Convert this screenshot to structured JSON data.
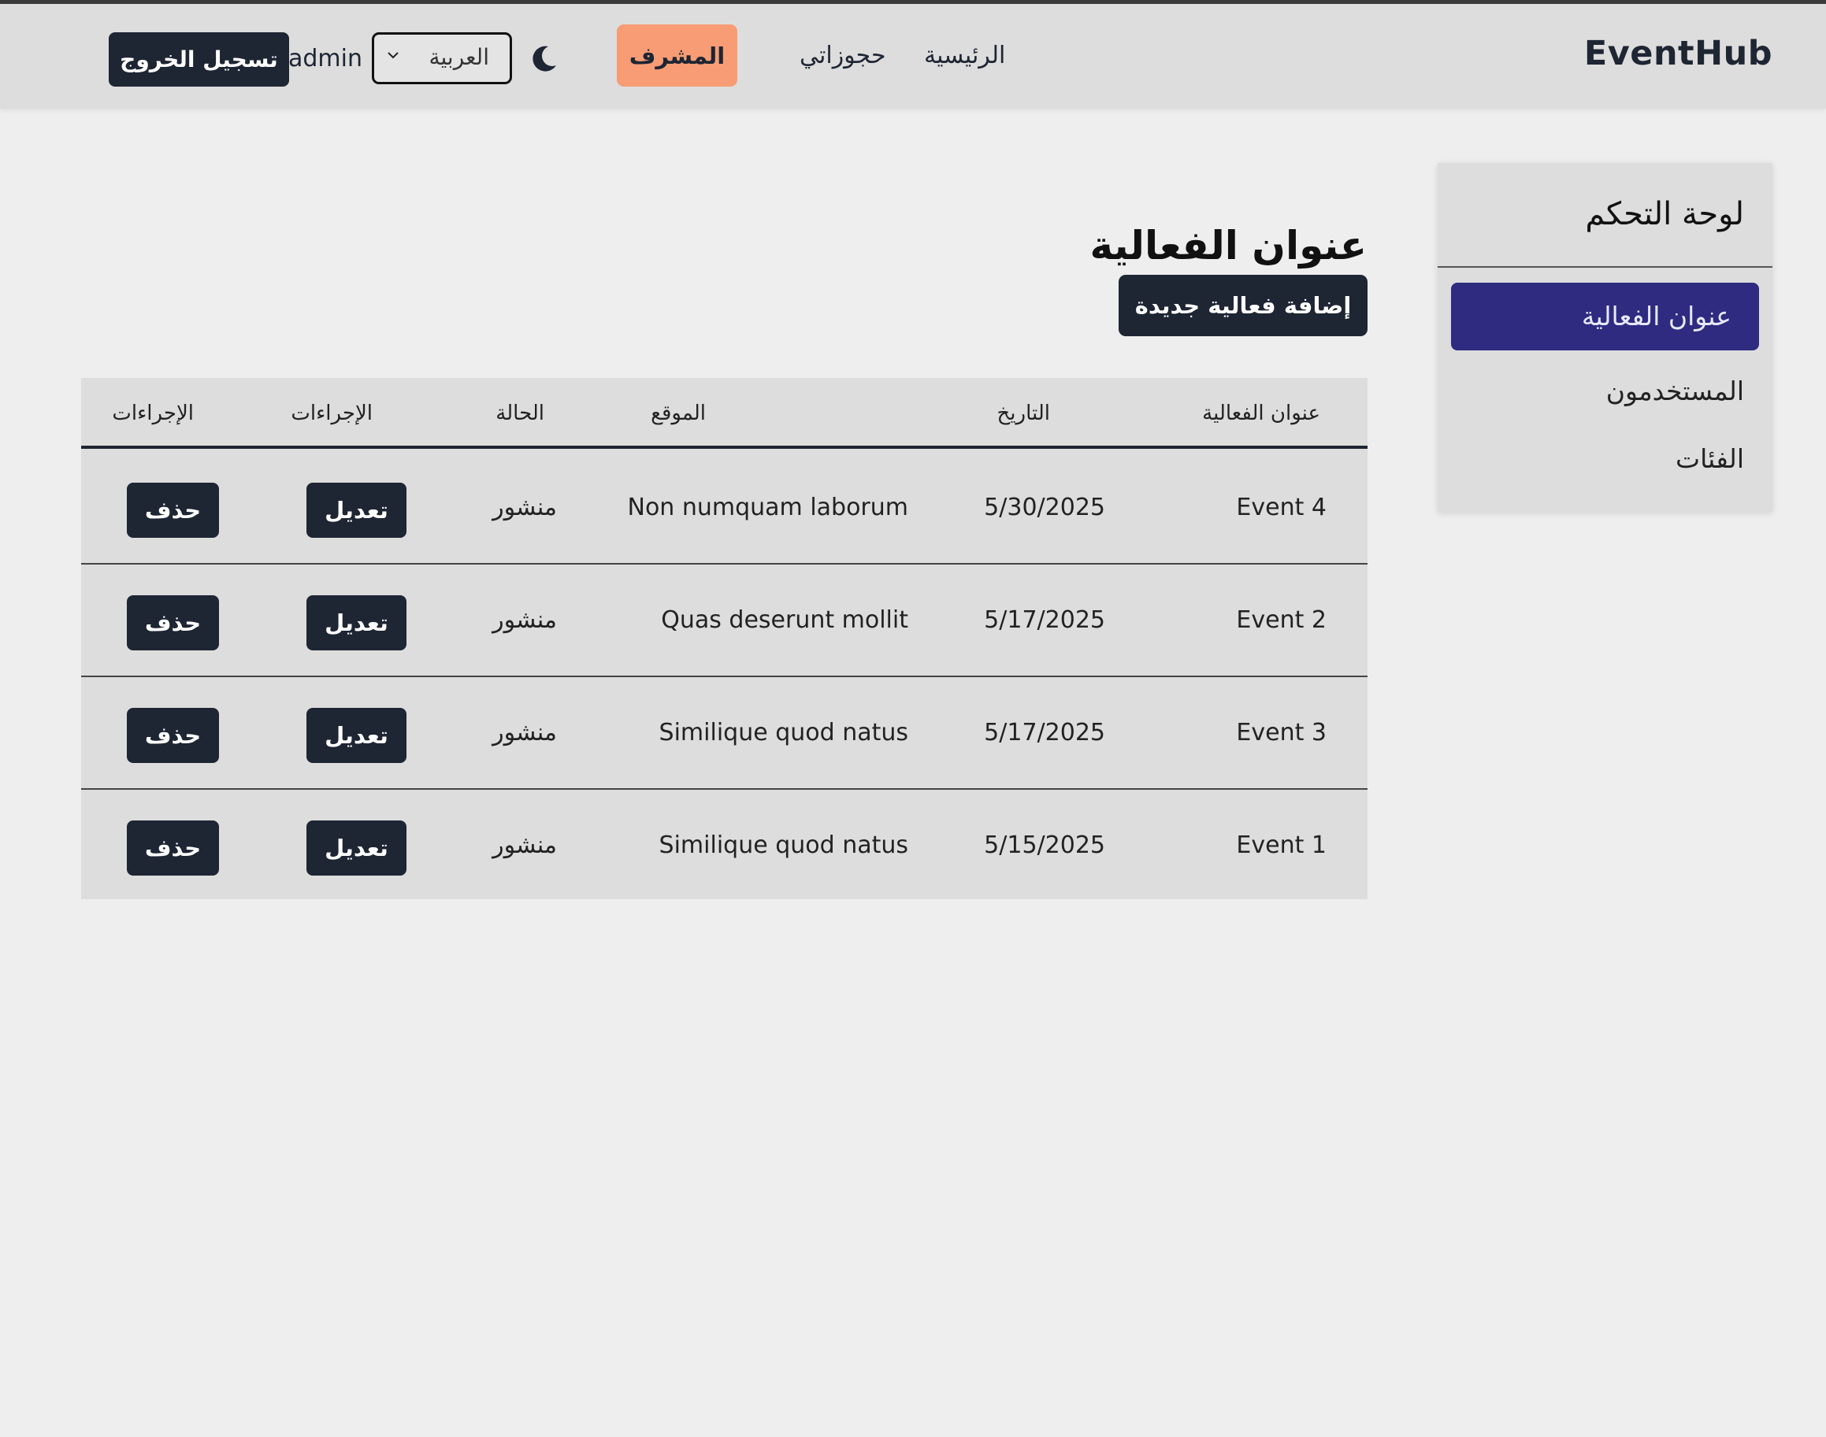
{
  "header": {
    "brand": "EventHub",
    "nav_home": "الرئيسية",
    "nav_bookings": "حجوزاتي",
    "nav_admin": "المشرف",
    "language_selected": "العربية",
    "username": "admin",
    "logout": "تسجيل الخروج"
  },
  "sidebar": {
    "title": "لوحة التحكم",
    "items": [
      {
        "label": "عنوان الفعالية"
      },
      {
        "label": "المستخدمون"
      },
      {
        "label": "الفئات"
      }
    ]
  },
  "main": {
    "title": "عنوان الفعالية",
    "add_button": "إضافة فعالية جديدة",
    "columns": [
      "عنوان الفعالية",
      "التاريخ",
      "الموقع",
      "الحالة",
      "الإجراءات",
      "الإجراءات"
    ],
    "rows": [
      {
        "title": "Event 4",
        "date": "5/30/2025",
        "location": "Non numquam laborum",
        "status": "منشور",
        "edit": "تعديل",
        "delete": "حذف"
      },
      {
        "title": "Event 2",
        "date": "5/17/2025",
        "location": "Quas deserunt mollit",
        "status": "منشور",
        "edit": "تعديل",
        "delete": "حذف"
      },
      {
        "title": "Event 3",
        "date": "5/17/2025",
        "location": "Similique quod natus",
        "status": "منشور",
        "edit": "تعديل",
        "delete": "حذف"
      },
      {
        "title": "Event 1",
        "date": "5/15/2025",
        "location": "Similique quod natus",
        "status": "منشور",
        "edit": "تعديل",
        "delete": "حذف"
      }
    ]
  },
  "colors": {
    "admin_accent": "#f79c74",
    "sidebar_active": "#2e2b80",
    "dark_button": "#1e2533"
  },
  "icons": [
    "moon-icon",
    "chevron-down-icon"
  ]
}
